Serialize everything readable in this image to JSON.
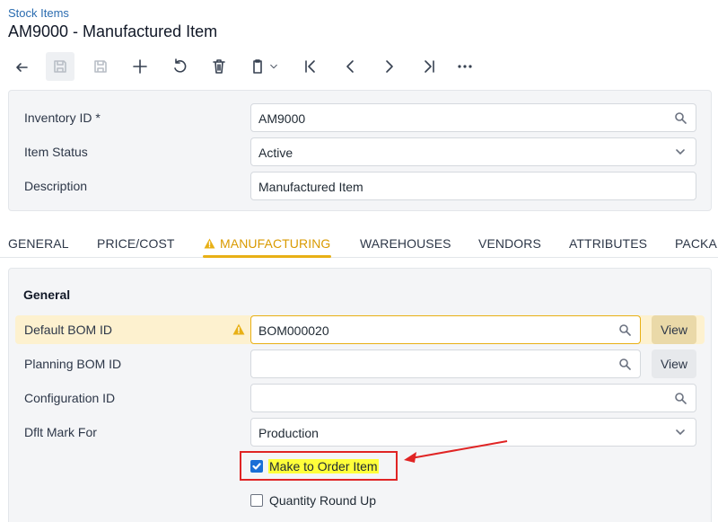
{
  "breadcrumb": "Stock Items",
  "title": "AM9000 - Manufactured Item",
  "toolbar": {
    "buttons": [
      "back-icon",
      "save-close-icon",
      "save-icon",
      "add-icon",
      "undo-icon",
      "delete-icon",
      "copy-paste-icon",
      "first-icon",
      "previous-icon",
      "next-icon",
      "last-icon",
      "more-icon"
    ]
  },
  "summary": {
    "inventory_id_label": "Inventory ID *",
    "inventory_id_value": "AM9000",
    "item_status_label": "Item Status",
    "item_status_value": "Active",
    "description_label": "Description",
    "description_value": "Manufactured Item"
  },
  "tabs": [
    "GENERAL",
    "PRICE/COST",
    "MANUFACTURING",
    "WAREHOUSES",
    "VENDORS",
    "ATTRIBUTES",
    "PACKA"
  ],
  "active_tab": "MANUFACTURING",
  "general": {
    "section_title": "General",
    "default_bom_label": "Default BOM ID",
    "default_bom_value": "BOM000020",
    "view_label": "View",
    "planning_bom_label": "Planning BOM ID",
    "planning_bom_value": "",
    "configuration_label": "Configuration ID",
    "configuration_value": "",
    "dflt_mark_label": "Dflt Mark For",
    "dflt_mark_value": "Production",
    "make_to_order_label": "Make to Order Item",
    "make_to_order_checked": true,
    "quantity_round_up_label": "Quantity Round Up",
    "quantity_round_up_checked": false
  },
  "colors": {
    "accent": "#e8b015",
    "link": "#2b6cb0",
    "checkbox": "#1a6fd6",
    "annotation": "#e02424",
    "highlight": "#ffff3a"
  }
}
